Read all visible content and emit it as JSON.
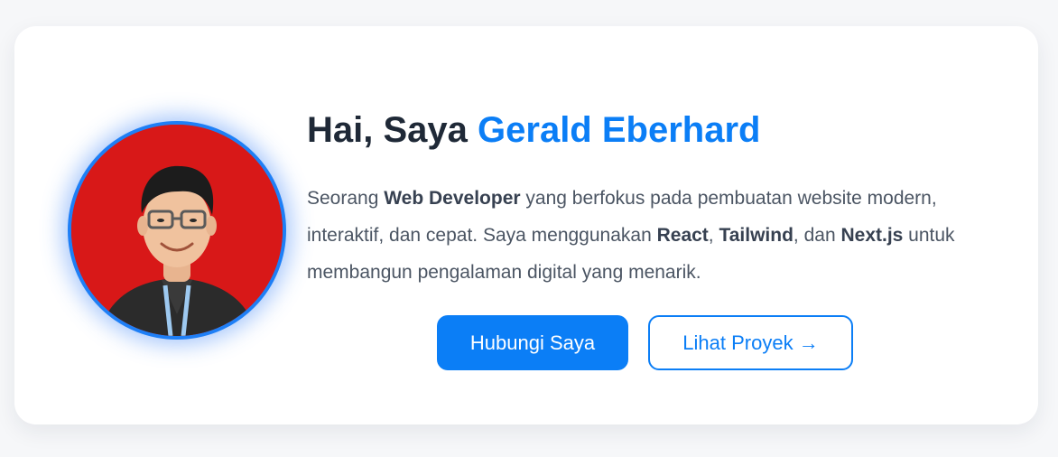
{
  "hero": {
    "greeting": "Hai, Saya ",
    "name": "Gerald Eberhard",
    "bio": [
      {
        "text": "Seorang ",
        "bold": false
      },
      {
        "text": "Web Developer",
        "bold": true
      },
      {
        "text": " yang berfokus pada pembuatan website modern, interaktif, dan cepat. Saya menggunakan ",
        "bold": false
      },
      {
        "text": "React",
        "bold": true
      },
      {
        "text": ", ",
        "bold": false
      },
      {
        "text": "Tailwind",
        "bold": true
      },
      {
        "text": ", dan ",
        "bold": false
      },
      {
        "text": "Next.js",
        "bold": true
      },
      {
        "text": " untuk membangun pengalaman digital yang menarik.",
        "bold": false
      }
    ],
    "primary_button": "Hubungi Saya",
    "secondary_button": "Lihat Proyek →",
    "avatar_icon": "profile-photo",
    "colors": {
      "accent": "#0b7ef6",
      "avatar_background": "#d81818",
      "heading": "#1f2937",
      "body_text": "#4b5563"
    }
  }
}
